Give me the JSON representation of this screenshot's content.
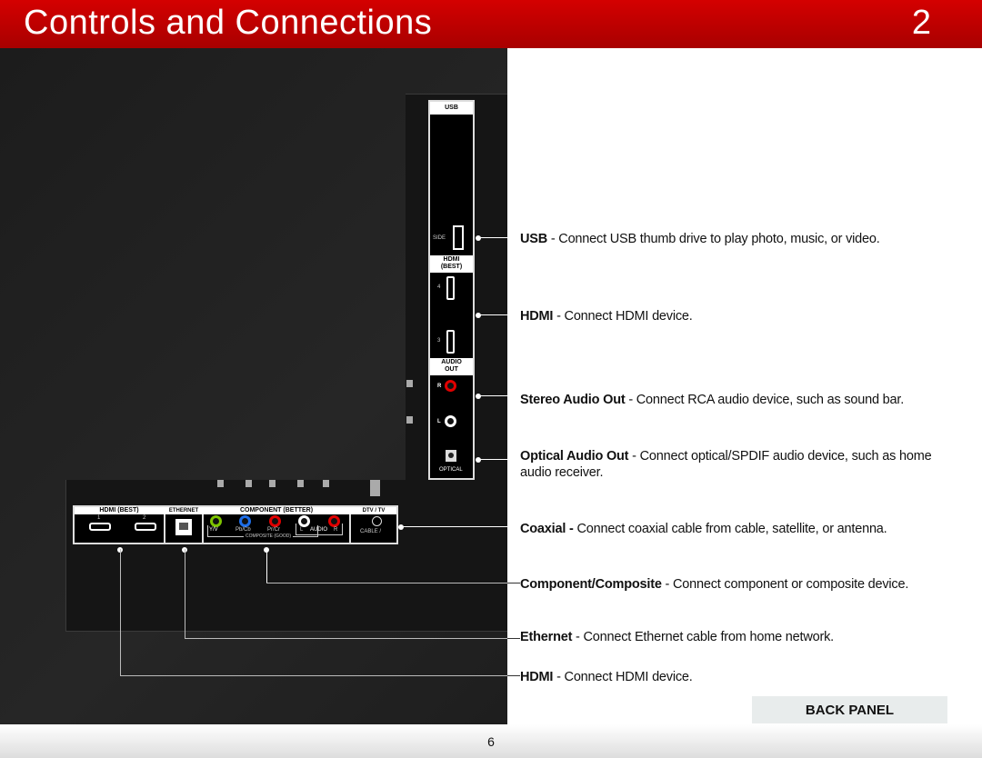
{
  "header": {
    "title": "Controls and Connections",
    "chapter": "2"
  },
  "side_panel": {
    "usb": "USB",
    "side": "SIDE",
    "hdmi": "HDMI (BEST)",
    "hdmi_4": "4",
    "hdmi_3": "3",
    "audio_out": "AUDIO OUT",
    "r": "R",
    "l": "L",
    "optical": "OPTICAL"
  },
  "bottom_panel": {
    "hdmi": "HDMI (BEST)",
    "hdmi_1": "1",
    "hdmi_2": "2",
    "ethernet": "ETHERNET",
    "component": "COMPONENT (BETTER)",
    "yv": "Y/V",
    "pbcb": "Pb/Cb",
    "prcr": "Pr/Cr",
    "audio_l": "L",
    "audio": "AUDIO",
    "audio_r": "R",
    "composite": "COMPOSITE (GOOD)",
    "dtv": "DTV / TV",
    "cable": "CABLE  /"
  },
  "colors": {
    "red": "#e00000",
    "green": "#7dc400",
    "blue": "#1e6ee8"
  },
  "callouts": [
    {
      "term": "USB",
      "text": " - Connect USB thumb drive to play photo, music, or video."
    },
    {
      "term": "HDMI",
      "text": " - Connect HDMI device."
    },
    {
      "term": "Stereo Audio Out",
      "text": " - Connect RCA audio device, such as sound bar."
    },
    {
      "term": "Optical Audio Out",
      "text": " - Connect optical/SPDIF audio device, such as home audio receiver."
    },
    {
      "term": "Coaxial -",
      "text": " Connect coaxial cable from cable, satellite, or antenna."
    },
    {
      "term": "Component/Composite",
      "text": " - Connect component or composite device."
    },
    {
      "term": "Ethernet",
      "text": " - Connect Ethernet cable from home network."
    },
    {
      "term": "HDMI",
      "text": " - Connect HDMI device."
    }
  ],
  "back_panel_label": "BACK PANEL",
  "page_number": "6"
}
